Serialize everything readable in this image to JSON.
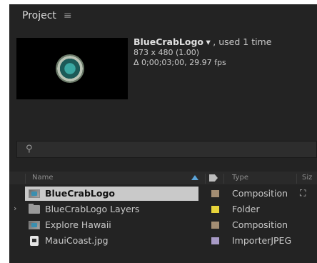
{
  "panel": {
    "title": "Project",
    "menu_icon": "≡"
  },
  "preview": {
    "name": "BlueCrabLogo",
    "dropdown_glyph": "▾",
    "usage": ", used 1 time",
    "dimensions": "873 x 480 (1.00)",
    "duration": "Δ 0;00;03;00, 29.97 fps"
  },
  "search": {
    "icon_glyph": "⚲",
    "value": ""
  },
  "columns": {
    "name": "Name",
    "type": "Type",
    "size": "Siz"
  },
  "items": [
    {
      "name": "BlueCrabLogo",
      "type": "Composition",
      "icon": "composition-icon",
      "label_color": "#a38d73",
      "selected": true,
      "expander": "",
      "flow": "⛶"
    },
    {
      "name": "BlueCrabLogo Layers",
      "type": "Folder",
      "icon": "folder-icon",
      "label_color": "#e6d33a",
      "selected": false,
      "expander": "›",
      "flow": ""
    },
    {
      "name": "Explore Hawaii",
      "type": "Composition",
      "icon": "composition-icon",
      "label_color": "#a38d73",
      "selected": false,
      "expander": "",
      "flow": ""
    },
    {
      "name": "MauiCoast.jpg",
      "type": "ImporterJPEG",
      "icon": "image-file-icon",
      "label_color": "#a79ac6",
      "selected": false,
      "expander": "",
      "flow": ""
    }
  ]
}
